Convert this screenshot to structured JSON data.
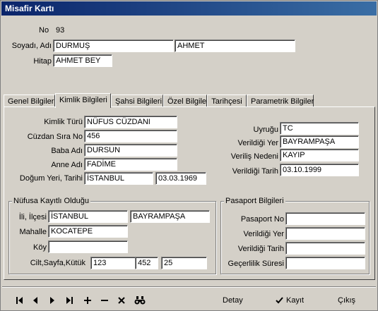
{
  "window": {
    "title": "Misafir Kartı"
  },
  "header": {
    "no_label": "No",
    "no_value": "93",
    "name_label": "Soyadı, Adı",
    "surname": "DURMUŞ",
    "firstname": "AHMET",
    "hitap_label": "Hitap",
    "hitap": "AHMET BEY"
  },
  "tabs": [
    {
      "label": "Genel Bilgiler",
      "active": false
    },
    {
      "label": "Kimlik Bilgileri",
      "active": true
    },
    {
      "label": "Şahsi Bilgileri",
      "active": false
    },
    {
      "label": "Özel Bilgiler",
      "active": false
    },
    {
      "label": "Tarihçesi",
      "active": false
    },
    {
      "label": "Parametrik Bilgiler",
      "active": false
    }
  ],
  "identity": {
    "kimlik_turu_label": "Kimlik Türü",
    "kimlik_turu": "NÜFUS CÜZDANI",
    "cuzdan_no_label": "Cüzdan Sıra No",
    "cuzdan_no": "456",
    "baba_label": "Baba Adı",
    "baba": "DURSUN",
    "anne_label": "Anne Adı",
    "anne": "FADİME",
    "dogum_label": "Doğum Yeri, Tarihi",
    "dogum_yeri": "İSTANBUL",
    "dogum_tarihi": "03.03.1969",
    "uyruk_label": "Uyruğu",
    "uyruk": "TC",
    "verildigi_yer_label": "Verildiği Yer",
    "verildigi_yer": "BAYRAMPAŞA",
    "verilis_nedeni_label": "Veriliş Nedeni",
    "verilis_nedeni": "KAYIP",
    "verildigi_tarih_label": "Verildiği Tarih",
    "verildigi_tarih": "03.10.1999"
  },
  "nufus": {
    "title": "Nüfusa Kayıtlı Olduğu",
    "il_label": "İli, İlçesi",
    "il": "İSTANBUL",
    "ilce": "BAYRAMPAŞA",
    "mahalle_label": "Mahalle",
    "mahalle": "KOCATEPE",
    "koy_label": "Köy",
    "koy": "",
    "cilt_label": "Cilt,Sayfa,Kütük",
    "cilt": "123",
    "sayfa": "452",
    "kutuk": "25"
  },
  "pasaport": {
    "title": "Pasaport Bilgileri",
    "no_label": "Pasaport No",
    "no": "",
    "yer_label": "Verildiği Yer",
    "yer": "",
    "tarih_label": "Verildiği Tarih",
    "tarih": "",
    "sure_label": "Geçerlilik Süresi",
    "sure": ""
  },
  "toolbar": {
    "nav_icons": [
      "first-record-icon",
      "prior-record-icon",
      "next-record-icon",
      "last-record-icon",
      "insert-icon",
      "delete-icon",
      "cancel-icon",
      "find-icon"
    ],
    "detay_label": "Detay",
    "kayit_label": "Kayıt",
    "cikis_label": "Çıkış"
  }
}
